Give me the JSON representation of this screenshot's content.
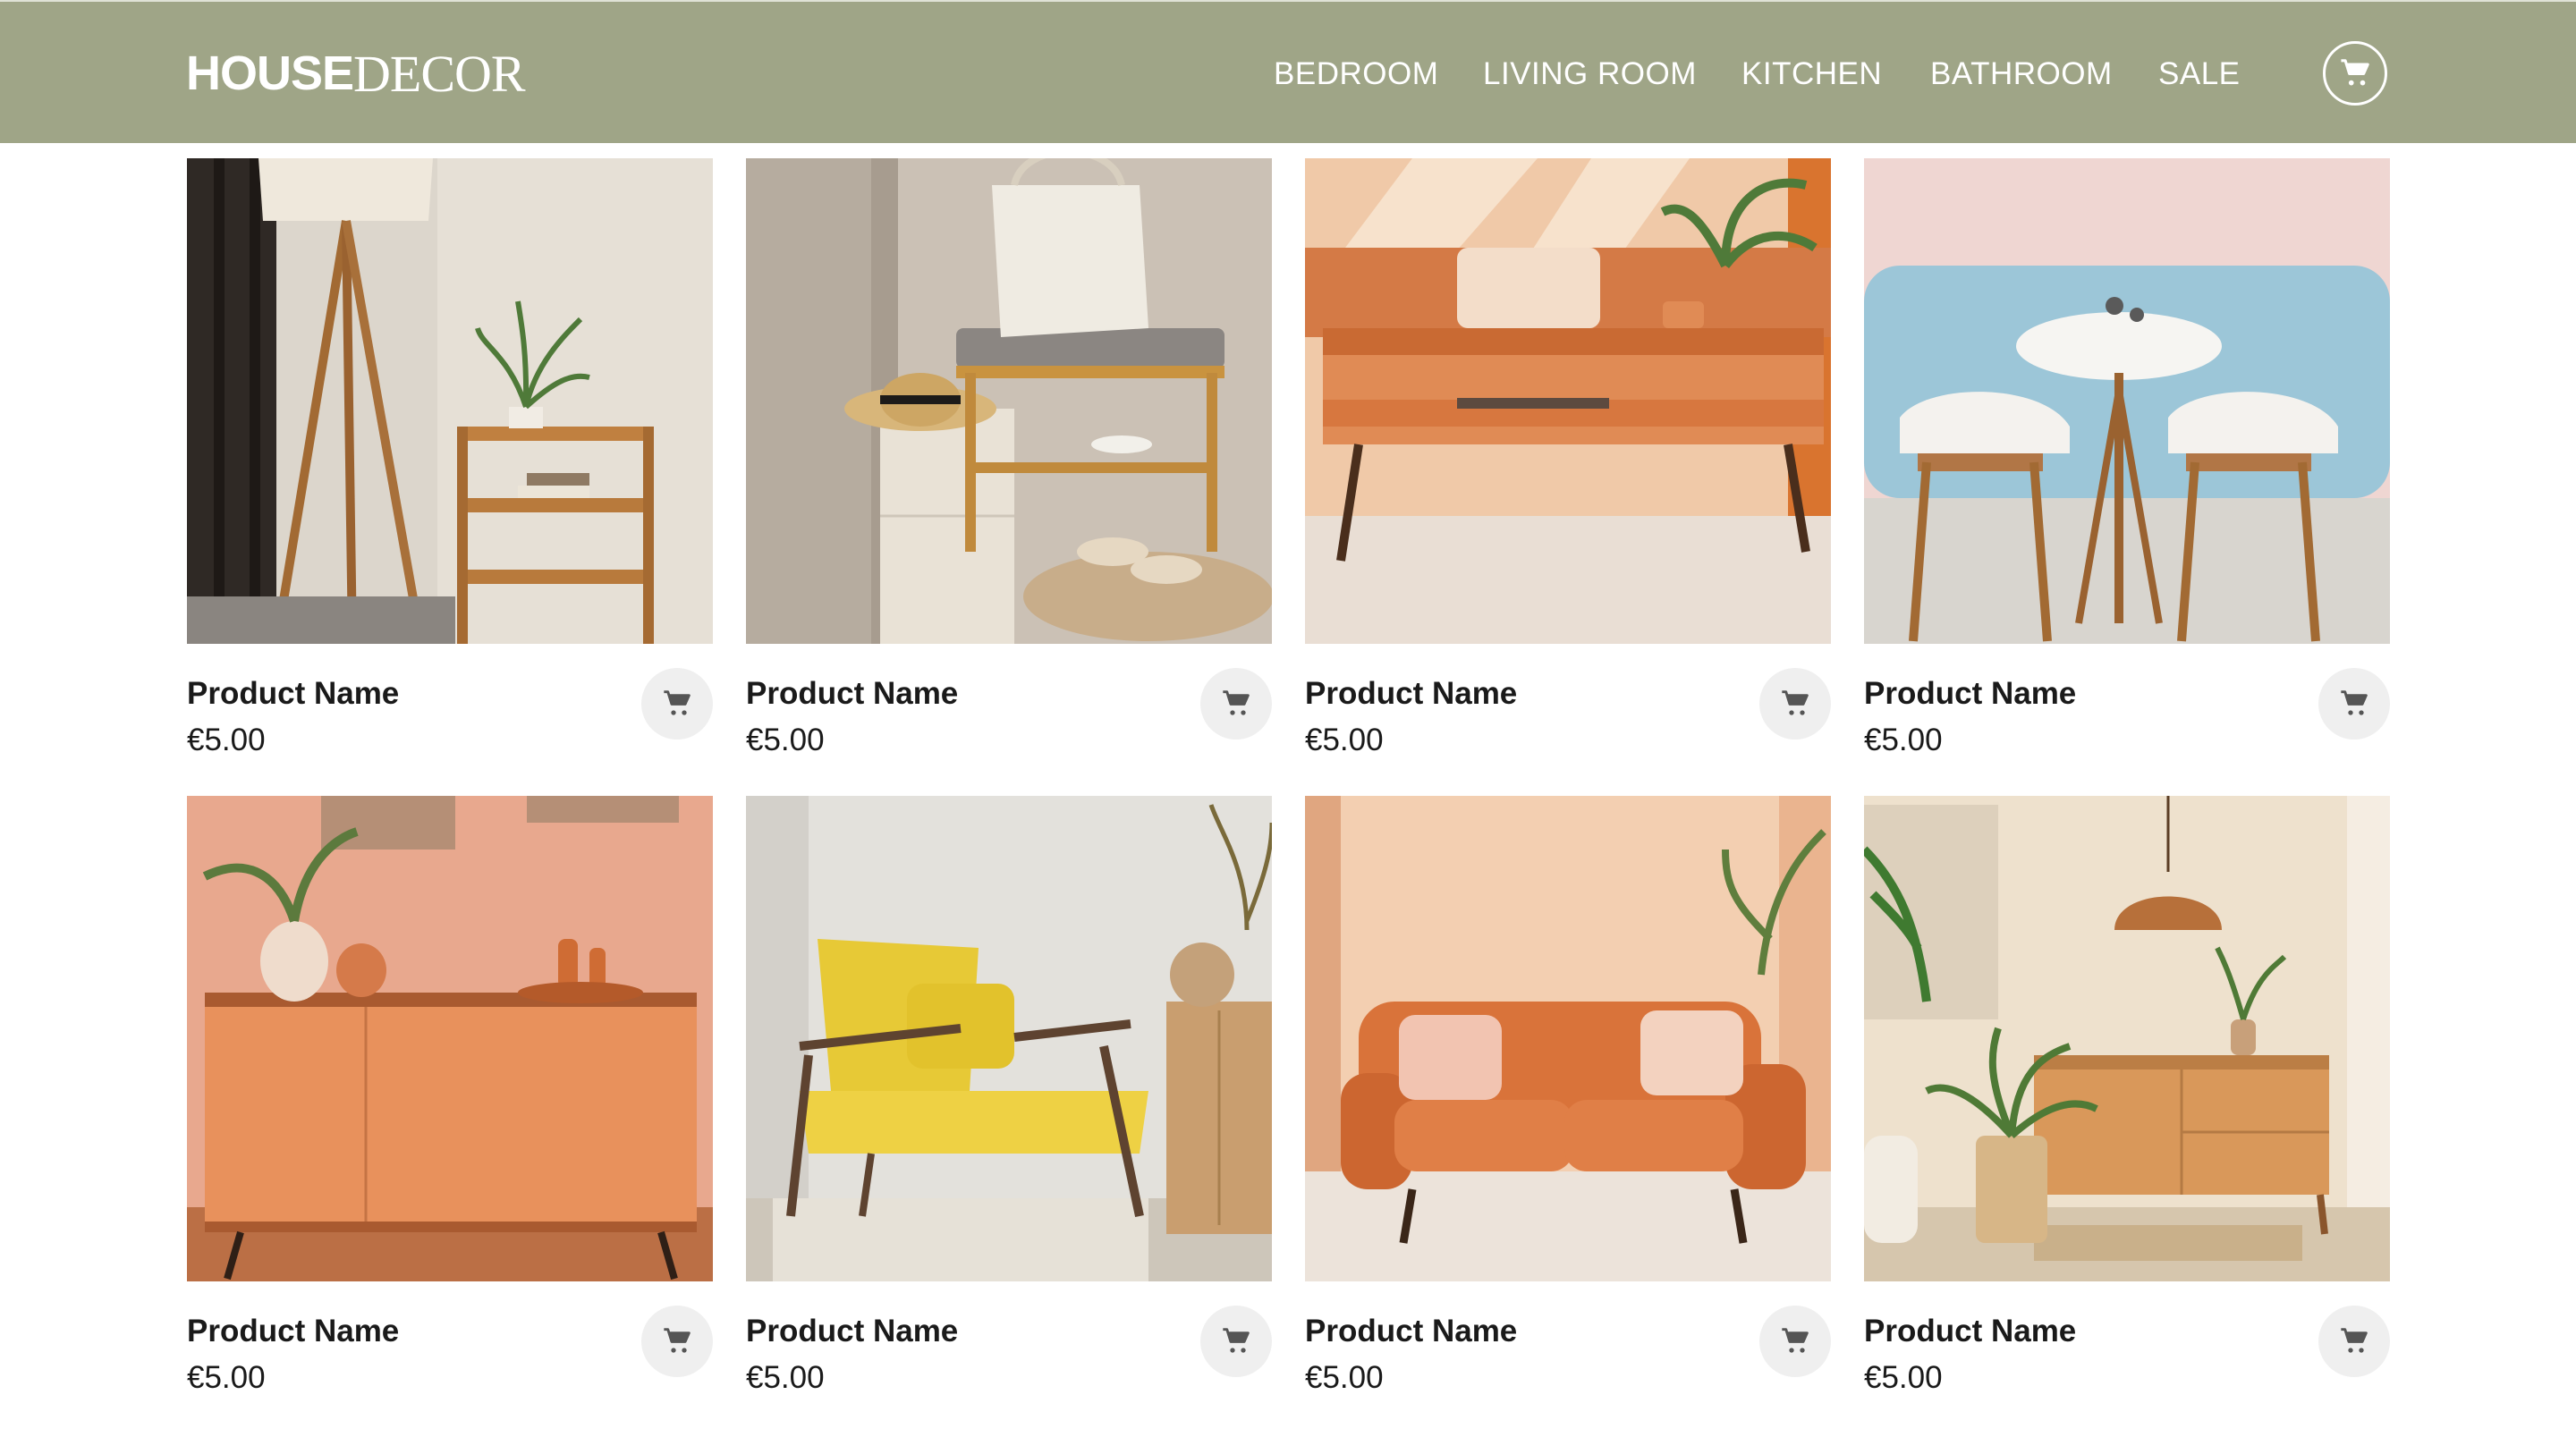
{
  "brand": {
    "name_bold": "HOUSE",
    "name_light": "DECOR"
  },
  "nav": {
    "items": [
      "BEDROOM",
      "LIVING ROOM",
      "KITCHEN",
      "BATHROOM",
      "SALE"
    ]
  },
  "header": {
    "cart_icon": "cart-icon"
  },
  "colors": {
    "header_bg": "#9fa587",
    "add_button_bg": "#efefef",
    "text": "#1a1a1a"
  },
  "products": [
    {
      "name": "Product Name",
      "price": "€5.00",
      "image": "tripod floor lamp beside bamboo shelf"
    },
    {
      "name": "Product Name",
      "price": "€5.00",
      "image": "bamboo shoe bench with tote bag"
    },
    {
      "name": "Product Name",
      "price": "€5.00",
      "image": "orange wooden coffee table"
    },
    {
      "name": "Product Name",
      "price": "€5.00",
      "image": "round dining table with two chairs"
    },
    {
      "name": "Product Name",
      "price": "€5.00",
      "image": "peach sideboard with vases"
    },
    {
      "name": "Product Name",
      "price": "€5.00",
      "image": "yellow wooden armchair"
    },
    {
      "name": "Product Name",
      "price": "€5.00",
      "image": "orange two-seater sofa"
    },
    {
      "name": "Product Name",
      "price": "€5.00",
      "image": "wooden console with pendant lamp and fern"
    }
  ]
}
